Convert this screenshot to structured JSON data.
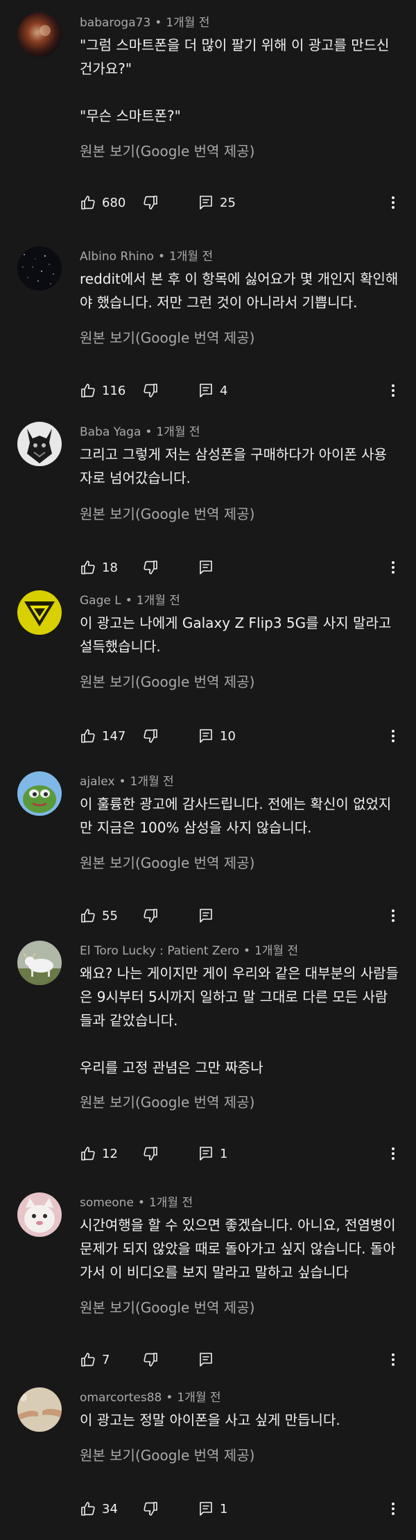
{
  "ui": {
    "translate_label": "원본 보기(Google 번역 제공)",
    "separator": "•"
  },
  "comments": [
    {
      "author": "babaroga73",
      "time": "1개월 전",
      "paragraphs": [
        "\"그럼 스마트폰을 더 많이 팔기 위해 이 광고를 만드신 건가요?\"",
        "\"무슨 스마트폰?\""
      ],
      "likes": "680",
      "replies": "25"
    },
    {
      "author": "Albino Rhino",
      "time": "1개월 전",
      "paragraphs": [
        "reddit에서 본 후 이 항목에 싫어요가 몇 개인지 확인해야 했습니다. 저만 그런 것이 아니라서 기쁩니다."
      ],
      "likes": "116",
      "replies": "4"
    },
    {
      "author": "Baba Yaga",
      "time": "1개월 전",
      "paragraphs": [
        "그리고 그렇게 저는 삼성폰을 구매하다가 아이폰 사용자로 넘어갔습니다."
      ],
      "likes": "18",
      "replies": ""
    },
    {
      "author": "Gage L",
      "time": "1개월 전",
      "paragraphs": [
        "이 광고는 나에게 Galaxy Z Flip3 5G를 사지 말라고 설득했습니다."
      ],
      "likes": "147",
      "replies": "10"
    },
    {
      "author": "ajalex",
      "time": "1개월 전",
      "paragraphs": [
        "이 훌륭한 광고에 감사드립니다. 전에는 확신이 없었지만 지금은 100% 삼성을 사지 않습니다."
      ],
      "likes": "55",
      "replies": ""
    },
    {
      "author": "El Toro Lucky : Patient Zero",
      "time": "1개월 전",
      "paragraphs": [
        "왜요? 나는 게이지만 게이 우리와 같은 대부분의 사람들은 9시부터 5시까지 일하고 말 그대로 다른 모든 사람들과 같았습니다.",
        "우리를 고정 관념은 그만 짜증나"
      ],
      "likes": "12",
      "replies": "1"
    },
    {
      "author": "someone",
      "time": "1개월 전",
      "paragraphs": [
        "시간여행을 할 수 있으면 좋겠습니다. 아니요, 전염병이 문제가 되지 않았을 때로 돌아가고 싶지 않습니다. 돌아가서 이 비디오를 보지 말라고 말하고 싶습니다"
      ],
      "likes": "7",
      "replies": ""
    },
    {
      "author": "omarcortes88",
      "time": "1개월 전",
      "paragraphs": [
        "이 광고는 정말 아이폰을 사고 싶게 만듭니다."
      ],
      "likes": "34",
      "replies": "1"
    }
  ]
}
